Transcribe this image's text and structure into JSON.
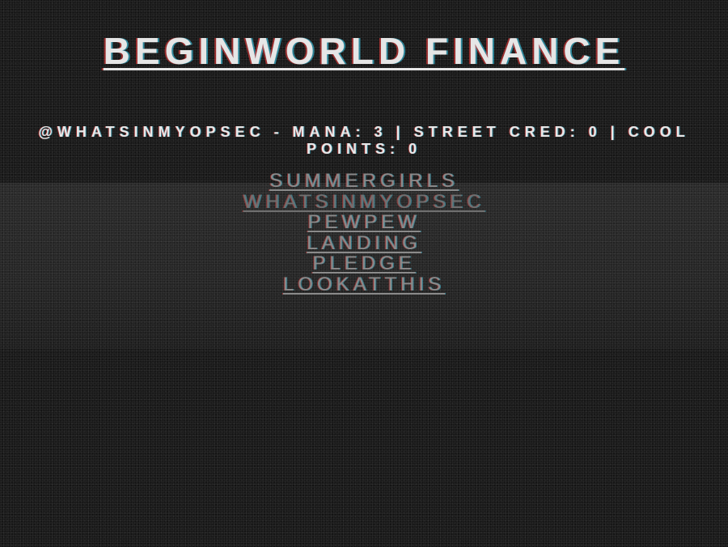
{
  "header": {
    "title": "BEGINWORLD FINANCE"
  },
  "status": {
    "line1": "@WHATSINMYOPSEC - MANA: 3 | STREET CRED: 0 | COOL",
    "line2": "POINTS: 0"
  },
  "nav": {
    "items": [
      {
        "label": "SUMMERGIRLS"
      },
      {
        "label": "WHATSINMYOPSEC"
      },
      {
        "label": "PEWPEW"
      },
      {
        "label": "LANDING"
      },
      {
        "label": "PLEDGE"
      },
      {
        "label": "LOOKATTHIS"
      }
    ]
  },
  "colors": {
    "background": "#1a1a1a",
    "title_text": "#e6e6e6",
    "link_text": "#8a8a8a"
  }
}
